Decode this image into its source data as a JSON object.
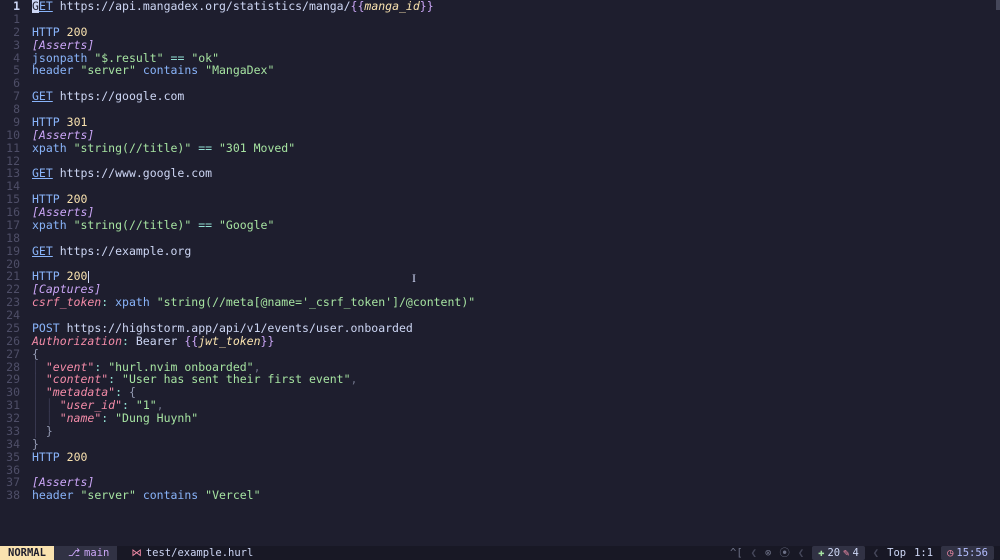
{
  "editor": {
    "total_lines": 38,
    "active_line": 1,
    "lines": [
      {
        "n": 1,
        "bar": "#89b4fa",
        "tokens": [
          [
            "cursor",
            "G"
          ],
          [
            "kw",
            "ET"
          ],
          [
            "plain",
            " "
          ],
          [
            "url",
            "https://api.mangadex.org/statistics/manga/"
          ],
          [
            "brace",
            "{{"
          ],
          [
            "var",
            "manga_id"
          ],
          [
            "brace",
            "}}"
          ]
        ]
      },
      {
        "n": 1,
        "bar": "",
        "tokens": []
      },
      {
        "n": 2,
        "bar": "#89b4fa",
        "tokens": [
          [
            "proto",
            "HTTP"
          ],
          [
            "plain",
            " "
          ],
          [
            "num",
            "200"
          ]
        ]
      },
      {
        "n": 3,
        "bar": "#89b4fa",
        "tokens": [
          [
            "sect",
            "[Asserts]"
          ]
        ]
      },
      {
        "n": 4,
        "bar": "#89b4fa",
        "tokens": [
          [
            "fn",
            "jsonpath"
          ],
          [
            "plain",
            " "
          ],
          [
            "str",
            "\"$.result\""
          ],
          [
            "plain",
            " "
          ],
          [
            "op",
            "=="
          ],
          [
            "plain",
            " "
          ],
          [
            "str",
            "\"ok\""
          ]
        ]
      },
      {
        "n": 5,
        "bar": "#89b4fa",
        "tokens": [
          [
            "fn",
            "header"
          ],
          [
            "plain",
            " "
          ],
          [
            "str",
            "\"server\""
          ],
          [
            "plain",
            " "
          ],
          [
            "fn",
            "contains"
          ],
          [
            "plain",
            " "
          ],
          [
            "str",
            "\"MangaDex\""
          ]
        ]
      },
      {
        "n": 6,
        "bar": "",
        "tokens": []
      },
      {
        "n": 7,
        "bar": "#89b4fa",
        "tokens": [
          [
            "kw",
            "GET"
          ],
          [
            "plain",
            " "
          ],
          [
            "url",
            "https://google.com"
          ]
        ]
      },
      {
        "n": 8,
        "bar": "",
        "tokens": []
      },
      {
        "n": 9,
        "bar": "#89b4fa",
        "tokens": [
          [
            "proto",
            "HTTP"
          ],
          [
            "plain",
            " "
          ],
          [
            "num",
            "301"
          ]
        ]
      },
      {
        "n": 10,
        "bar": "#89b4fa",
        "tokens": [
          [
            "sect",
            "[Asserts]"
          ]
        ]
      },
      {
        "n": 11,
        "bar": "#89b4fa",
        "tokens": [
          [
            "fn",
            "xpath"
          ],
          [
            "plain",
            " "
          ],
          [
            "str",
            "\"string(//title)\""
          ],
          [
            "plain",
            " "
          ],
          [
            "op",
            "=="
          ],
          [
            "plain",
            " "
          ],
          [
            "str",
            "\"301 Moved\""
          ]
        ]
      },
      {
        "n": 12,
        "bar": "",
        "tokens": []
      },
      {
        "n": 13,
        "bar": "#89b4fa",
        "tokens": [
          [
            "kw",
            "GET"
          ],
          [
            "plain",
            " "
          ],
          [
            "url",
            "https://www.google.com"
          ]
        ]
      },
      {
        "n": 14,
        "bar": "",
        "tokens": []
      },
      {
        "n": 15,
        "bar": "#89b4fa",
        "tokens": [
          [
            "proto",
            "HTTP"
          ],
          [
            "plain",
            " "
          ],
          [
            "num",
            "200"
          ]
        ]
      },
      {
        "n": 16,
        "bar": "#89b4fa",
        "tokens": [
          [
            "sect",
            "[Asserts]"
          ]
        ]
      },
      {
        "n": 17,
        "bar": "#89b4fa",
        "tokens": [
          [
            "fn",
            "xpath"
          ],
          [
            "plain",
            " "
          ],
          [
            "str",
            "\"string(//title)\""
          ],
          [
            "plain",
            " "
          ],
          [
            "op",
            "=="
          ],
          [
            "plain",
            " "
          ],
          [
            "str",
            "\"Google\""
          ]
        ]
      },
      {
        "n": 18,
        "bar": "",
        "tokens": []
      },
      {
        "n": 19,
        "bar": "#89b4fa",
        "tokens": [
          [
            "kw",
            "GET"
          ],
          [
            "plain",
            " "
          ],
          [
            "url",
            "https://example.org"
          ]
        ]
      },
      {
        "n": 20,
        "bar": "",
        "tokens": []
      },
      {
        "n": 21,
        "bar": "#89b4fa",
        "tokens": [
          [
            "proto",
            "HTTP"
          ],
          [
            "plain",
            " "
          ],
          [
            "num",
            "200"
          ],
          [
            "ibeam",
            ""
          ]
        ]
      },
      {
        "n": 22,
        "bar": "#89b4fa",
        "tokens": [
          [
            "sect",
            "[Captures]"
          ]
        ]
      },
      {
        "n": 23,
        "bar": "#89b4fa",
        "tokens": [
          [
            "ident",
            "csrf_token"
          ],
          [
            "colon",
            ":"
          ],
          [
            "plain",
            " "
          ],
          [
            "fn",
            "xpath"
          ],
          [
            "plain",
            " "
          ],
          [
            "str",
            "\"string(//meta[@name='_csrf_token']/@content)\""
          ]
        ]
      },
      {
        "n": 24,
        "bar": "",
        "tokens": []
      },
      {
        "n": 25,
        "bar": "#89b4fa",
        "tokens": [
          [
            "proto",
            "POST"
          ],
          [
            "plain",
            " "
          ],
          [
            "url",
            "https://highstorm.app/api/v1/events/user.onboarded"
          ]
        ]
      },
      {
        "n": 26,
        "bar": "#89b4fa",
        "tokens": [
          [
            "ident",
            "Authorization"
          ],
          [
            "colon",
            ":"
          ],
          [
            "plain",
            " Bearer "
          ],
          [
            "brace",
            "{{"
          ],
          [
            "var",
            "jwt_token"
          ],
          [
            "brace",
            "}}"
          ]
        ]
      },
      {
        "n": 27,
        "bar": "#89b4fa",
        "tokens": [
          [
            "brkt",
            "{"
          ]
        ]
      },
      {
        "n": 28,
        "bar": "#89b4fa",
        "tokens": [
          [
            "indg",
            "│ "
          ],
          [
            "ident",
            "\"event\""
          ],
          [
            "colon",
            ":"
          ],
          [
            "plain",
            " "
          ],
          [
            "str",
            "\"hurl.nvim onboarded\""
          ],
          [
            "punct",
            ","
          ]
        ]
      },
      {
        "n": 29,
        "bar": "#89b4fa",
        "tokens": [
          [
            "indg",
            "│ "
          ],
          [
            "ident",
            "\"content\""
          ],
          [
            "colon",
            ":"
          ],
          [
            "plain",
            " "
          ],
          [
            "str",
            "\"User has sent their first event\""
          ],
          [
            "punct",
            ","
          ]
        ]
      },
      {
        "n": 30,
        "bar": "#89b4fa",
        "tokens": [
          [
            "indg",
            "│ "
          ],
          [
            "ident",
            "\"metadata\""
          ],
          [
            "colon",
            ":"
          ],
          [
            "plain",
            " "
          ],
          [
            "brkt",
            "{"
          ]
        ]
      },
      {
        "n": 31,
        "bar": "#89b4fa",
        "tokens": [
          [
            "indg",
            "│ │ "
          ],
          [
            "ident",
            "\"user_id\""
          ],
          [
            "colon",
            ":"
          ],
          [
            "plain",
            " "
          ],
          [
            "str",
            "\"1\""
          ],
          [
            "punct",
            ","
          ]
        ]
      },
      {
        "n": 32,
        "bar": "#89b4fa",
        "tokens": [
          [
            "indg",
            "│ │ "
          ],
          [
            "ident",
            "\"name\""
          ],
          [
            "colon",
            ":"
          ],
          [
            "plain",
            " "
          ],
          [
            "str",
            "\"Dung Huynh\""
          ]
        ]
      },
      {
        "n": 33,
        "bar": "#89b4fa",
        "tokens": [
          [
            "indg",
            "│ "
          ],
          [
            "brkt",
            "}"
          ]
        ]
      },
      {
        "n": 34,
        "bar": "#89b4fa",
        "tokens": [
          [
            "brkt",
            "}"
          ]
        ]
      },
      {
        "n": 35,
        "bar": "#89b4fa",
        "tokens": [
          [
            "proto",
            "HTTP"
          ],
          [
            "plain",
            " "
          ],
          [
            "num",
            "200"
          ]
        ]
      },
      {
        "n": 36,
        "bar": "",
        "tokens": []
      },
      {
        "n": 37,
        "bar": "#89b4fa",
        "tokens": [
          [
            "sect",
            "[Asserts]"
          ]
        ]
      },
      {
        "n": 38,
        "bar": "#89b4fa",
        "tokens": [
          [
            "fn",
            "header"
          ],
          [
            "plain",
            " "
          ],
          [
            "str",
            "\"server\""
          ],
          [
            "plain",
            " "
          ],
          [
            "fn",
            "contains"
          ],
          [
            "plain",
            " "
          ],
          [
            "str",
            "\"Vercel\""
          ]
        ]
      }
    ]
  },
  "status": {
    "mode": "NORMAL",
    "branch": "main",
    "filename": "test/example.hurl",
    "indicators": {
      "ctrl": "^[",
      "lsp1": "⊗",
      "lsp2": "⦿",
      "added": "20",
      "modified": "4"
    },
    "position": {
      "percent": "Top",
      "line_col": "1:1"
    },
    "clock": "15:56"
  }
}
